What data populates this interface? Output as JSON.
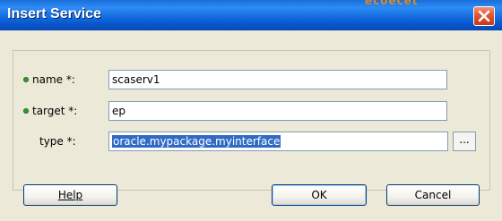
{
  "window": {
    "title": "Insert Service",
    "ghost_text": "ecoecet"
  },
  "form": {
    "name_label": "name *:",
    "name_value": "scaserv1",
    "target_label": "target *:",
    "target_value": "ep",
    "type_label": "type *:",
    "type_value": "oracle.mypackage.myinterface",
    "browse_label": "..."
  },
  "buttons": {
    "help": "Help",
    "ok": "OK",
    "cancel": "Cancel"
  },
  "colors": {
    "titlebar": "#0a5fd4",
    "dialog_bg": "#ece9d8",
    "selection": "#316ac5",
    "required_dot": "#2ea02e"
  }
}
